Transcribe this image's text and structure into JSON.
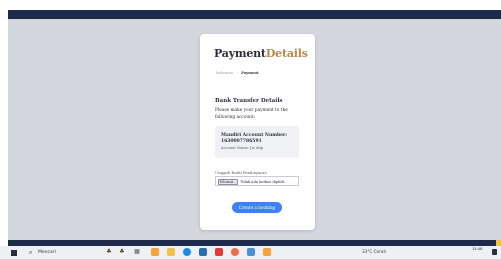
{
  "brand": {
    "part1": "Payment",
    "part2": "Details"
  },
  "breadcrumb": {
    "step1": "Informasi",
    "separator": "›",
    "step2": "Payment"
  },
  "section": {
    "title": "Bank Transfer Details",
    "description": "Please make your payment to the following account:"
  },
  "account": {
    "label": "Mandiri Account Number:",
    "number": "1630007786591",
    "name": "Account Name: Jiz Atlp"
  },
  "upload": {
    "label": "Unggah Bukti Pembayaran",
    "button_label": "Telusuri...",
    "file_status": "Tidak ada berkas dipilih."
  },
  "cta": {
    "label": "Create a booking"
  },
  "taskbar": {
    "search_placeholder": "Mencari",
    "weather": "33°C Cerah",
    "time": "15:48",
    "date": "..."
  },
  "colors": {
    "brand_dark": "#2b2f3a",
    "brand_gold": "#b5894a",
    "primary_button": "#3b82f6",
    "header_strip": "#1e2a4a",
    "page_bg": "#d3d6dd"
  }
}
